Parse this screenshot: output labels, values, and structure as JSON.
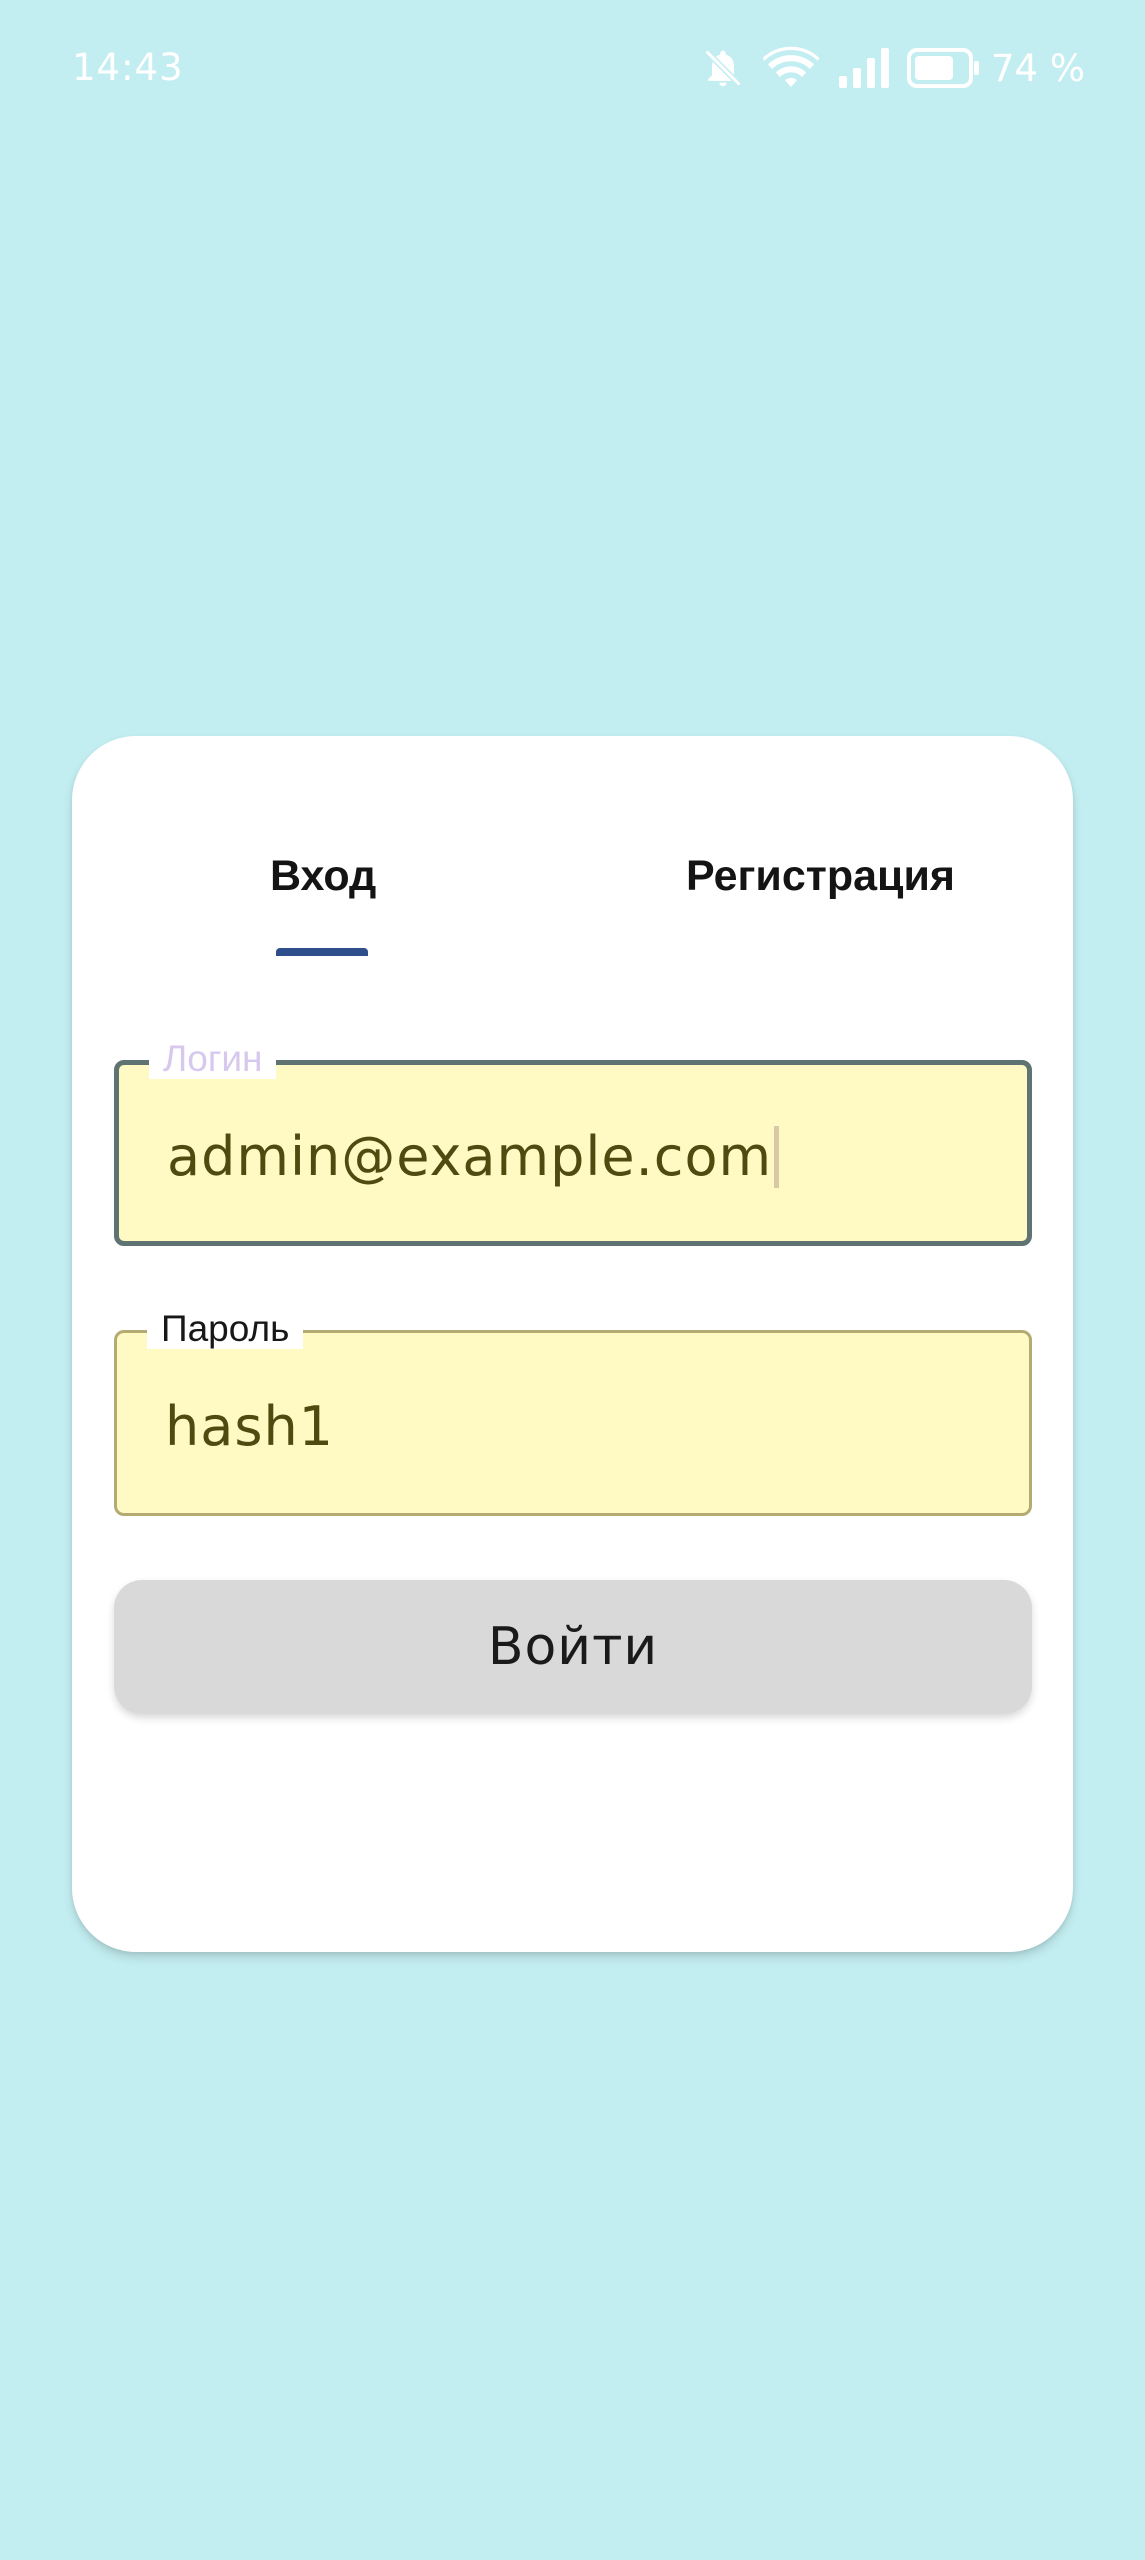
{
  "status_bar": {
    "time": "14:43",
    "battery_text": "74 %",
    "icons": [
      "bell-off-icon",
      "wifi-icon",
      "signal-icon",
      "battery-icon"
    ]
  },
  "auth_card": {
    "tabs": {
      "login_label": "Вход",
      "register_label": "Регистрация",
      "active": "login"
    },
    "login_field": {
      "label": "Логин",
      "value": "admin@example.com"
    },
    "password_field": {
      "label": "Пароль",
      "value": "hash1"
    },
    "submit_label": "Войти"
  },
  "colors": {
    "background": "#c3eef1",
    "card": "#ffffff",
    "field_fill": "#fff9c4",
    "tab_indicator": "#2f4f8c",
    "button": "#d9d9d9"
  }
}
